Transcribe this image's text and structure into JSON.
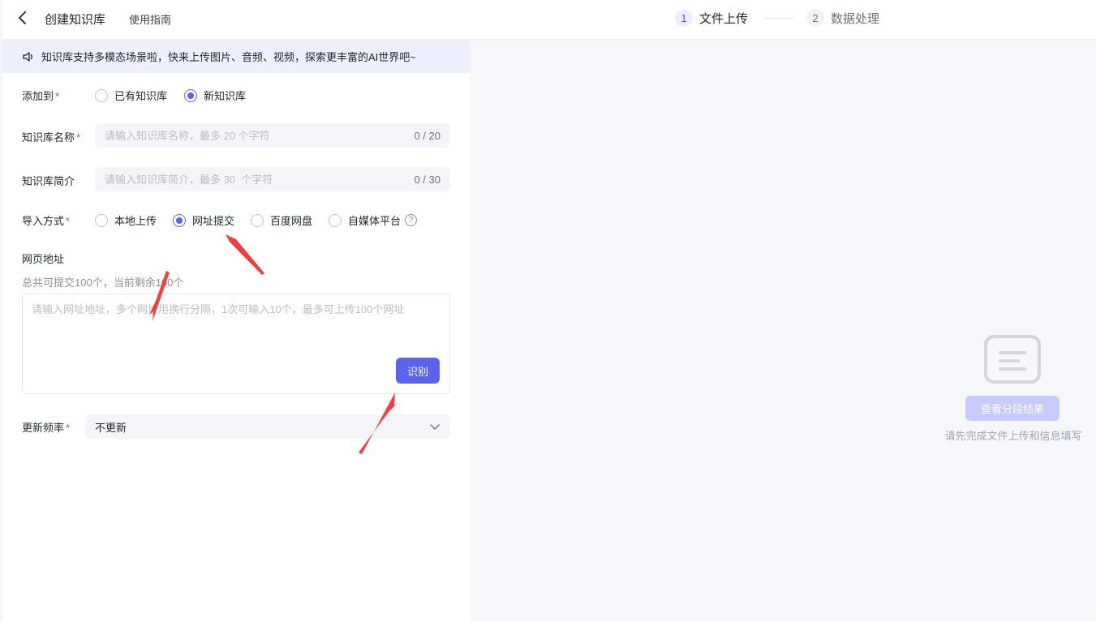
{
  "header": {
    "title": "创建知识库",
    "guide_label": "使用指南",
    "steps": [
      {
        "num": "1",
        "label": "文件上传"
      },
      {
        "num": "2",
        "label": "数据处理"
      }
    ]
  },
  "notice": {
    "text": "知识库支持多模态场景啦，快来上传图片、音频、视频，探索更丰富的AI世界吧~"
  },
  "add_to": {
    "label": "添加到",
    "required": "*",
    "options": [
      {
        "label": "已有知识库",
        "selected": false
      },
      {
        "label": "新知识库",
        "selected": true
      }
    ]
  },
  "kb_name": {
    "label": "知识库名称",
    "required": "*",
    "placeholder": "请输入知识库名称，最多 20 个字符",
    "counter": "0 / 20"
  },
  "kb_desc": {
    "label": "知识库简介",
    "placeholder": "请输入知识库简介，最多 30  个字符",
    "counter": "0 / 30"
  },
  "import_method": {
    "label": "导入方式",
    "required": "*",
    "options": [
      {
        "label": "本地上传",
        "selected": false
      },
      {
        "label": "网址提交",
        "selected": true
      },
      {
        "label": "百度网盘",
        "selected": false
      },
      {
        "label": "自媒体平台",
        "selected": false
      }
    ],
    "help_glyph": "?"
  },
  "url_section": {
    "label": "网页地址",
    "sub": "总共可提交100个，当前剩余100个",
    "placeholder": "请输入网址地址，多个网址用换行分隔，1次可输入10个，最多可上传100个网址",
    "identify_label": "识别"
  },
  "update_freq": {
    "label": "更新频率",
    "required": "*",
    "value": "不更新"
  },
  "right_panel": {
    "button_label": "查看分段结果",
    "hint": "请先完成文件上传和信息填写"
  },
  "colors": {
    "accent": "#5a63ec",
    "notice_bg": "#edeffd",
    "annotation_arrow": "#f03d3d"
  }
}
